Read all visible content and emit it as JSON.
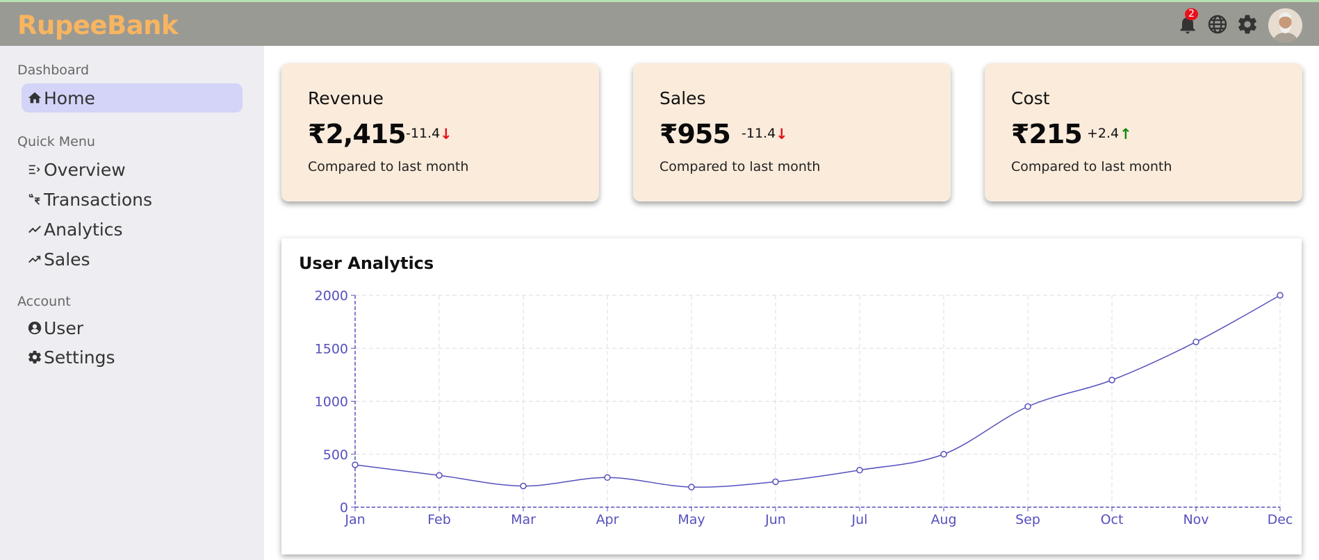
{
  "header": {
    "logo": "RupeeBank",
    "notification_count": "2",
    "icons": [
      "bell-icon",
      "globe-icon",
      "gear-icon",
      "avatar"
    ]
  },
  "sidebar": {
    "sections": [
      {
        "title": "Dashboard",
        "items": [
          {
            "label": "Home",
            "icon": "home-icon",
            "active": true
          }
        ]
      },
      {
        "title": "Quick Menu",
        "items": [
          {
            "label": "Overview",
            "icon": "overview-icon"
          },
          {
            "label": "Transactions",
            "icon": "transactions-icon"
          },
          {
            "label": "Analytics",
            "icon": "analytics-icon"
          },
          {
            "label": "Sales",
            "icon": "sales-icon"
          }
        ]
      },
      {
        "title": "Account",
        "items": [
          {
            "label": "User",
            "icon": "user-icon"
          },
          {
            "label": "Settings",
            "icon": "settings-icon"
          }
        ]
      }
    ]
  },
  "cards": [
    {
      "title": "Revenue",
      "value": "₹2,415",
      "change": "-11.4",
      "direction": "down",
      "note": "Compared to last month"
    },
    {
      "title": "Sales",
      "value": "₹955",
      "change": "-11.4",
      "direction": "down",
      "note": "Compared to last month"
    },
    {
      "title": "Cost",
      "value": "₹215",
      "change": "+2.4",
      "direction": "up",
      "note": "Compared to last month"
    }
  ],
  "colors": {
    "accent": "#5550bd",
    "logo": "#f8b560",
    "down": "#e8101c",
    "up": "#108a10",
    "card_bg": "#faebdb",
    "active_nav": "#d3d4f7"
  },
  "chart": {
    "title": "User Analytics",
    "chart_data": {
      "type": "line",
      "categories": [
        "Jan",
        "Feb",
        "Mar",
        "Apr",
        "May",
        "Jun",
        "Jul",
        "Aug",
        "Sep",
        "Oct",
        "Nov",
        "Dec"
      ],
      "series": [
        {
          "values": [
            400,
            300,
            200,
            280,
            190,
            240,
            350,
            500,
            950,
            1200,
            1560,
            2000
          ]
        }
      ],
      "ylim": [
        0,
        2000
      ],
      "yticks": [
        0,
        500,
        1000,
        1500,
        2000
      ],
      "grid": true,
      "xlabel": "",
      "ylabel": ""
    }
  }
}
